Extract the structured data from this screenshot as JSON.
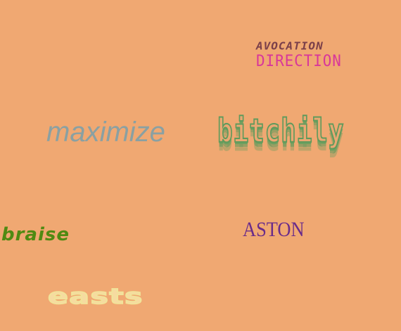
{
  "words": {
    "avocation": "AVOCATION",
    "direction": "DIRECTION",
    "maximize": "maximize",
    "bitchily": "bitchily",
    "braise": "braise",
    "aston": "ASTON",
    "easts": "easts"
  },
  "colors": {
    "background": "#f0a872",
    "avocation": "#7a3f4a",
    "direction": "#d8379a",
    "maximize": "#8aa0a2",
    "bitchily": "#5f9a5c",
    "braise": "#4f8a12",
    "aston": "#6a2c8a",
    "easts": "#f6dba0"
  }
}
